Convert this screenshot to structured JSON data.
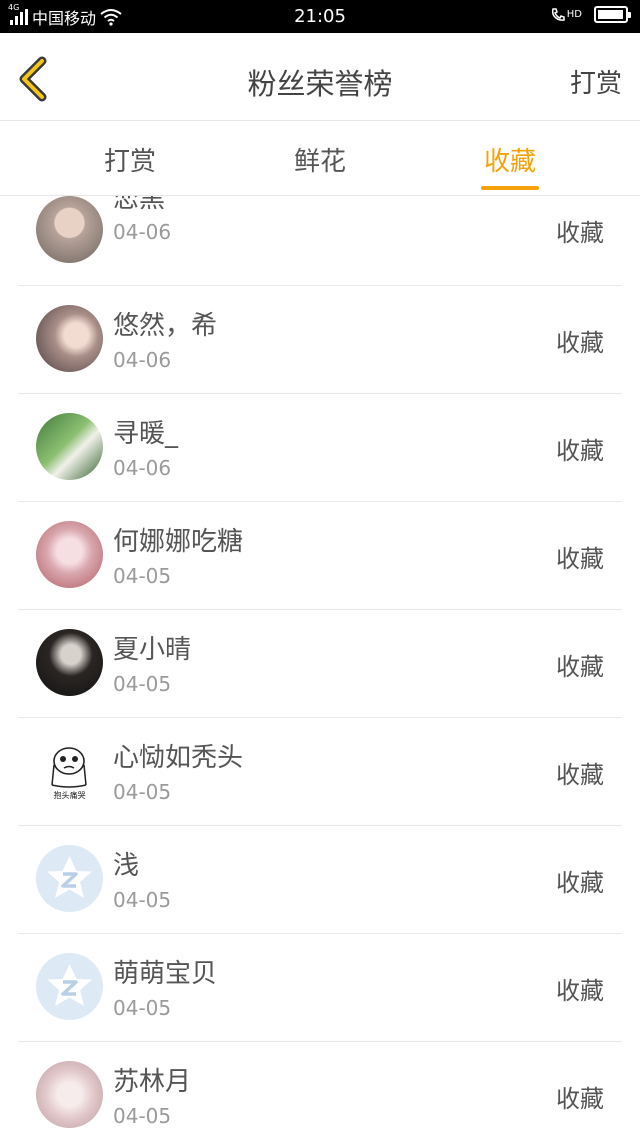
{
  "status_bar": {
    "network": "4G",
    "carrier": "中国移动",
    "time": "21:05",
    "hd_badge": "HD",
    "battery_level": 0.95,
    "icons": [
      "signal-icon",
      "wifi-icon",
      "hd-call-icon",
      "battery-icon"
    ]
  },
  "header": {
    "title": "粉丝荣誉榜",
    "action_label": "打赏",
    "back_icon": "chevron-left-icon",
    "accent_color": "#f5a20a"
  },
  "tabs": [
    {
      "label": "打赏",
      "active": false
    },
    {
      "label": "鲜花",
      "active": false
    },
    {
      "label": "收藏",
      "active": true
    }
  ],
  "fans": [
    {
      "name": "恋黑",
      "date": "04-06",
      "action": "收藏",
      "avatar": "photo-avatar"
    },
    {
      "name": "悠然，希",
      "date": "04-06",
      "action": "收藏",
      "avatar": "photo-avatar"
    },
    {
      "name": "寻暖_",
      "date": "04-06",
      "action": "收藏",
      "avatar": "photo-avatar"
    },
    {
      "name": "何娜娜吃糖",
      "date": "04-05",
      "action": "收藏",
      "avatar": "photo-avatar"
    },
    {
      "name": "夏小晴",
      "date": "04-05",
      "action": "收藏",
      "avatar": "photo-avatar"
    },
    {
      "name": "心恸如秃头",
      "date": "04-05",
      "action": "收藏",
      "avatar": "meme-avatar",
      "avatar_caption": "抱头痛哭"
    },
    {
      "name": "浅",
      "date": "04-05",
      "action": "收藏",
      "avatar": "default-avatar"
    },
    {
      "name": "萌萌宝贝",
      "date": "04-05",
      "action": "收藏",
      "avatar": "default-avatar"
    },
    {
      "name": "苏林月",
      "date": "04-05",
      "action": "收藏",
      "avatar": "photo-avatar"
    }
  ]
}
